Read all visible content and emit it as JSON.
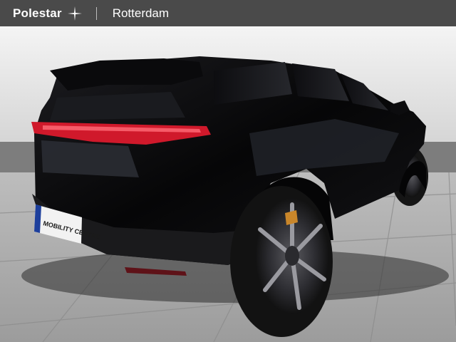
{
  "header": {
    "brand": "Polestar",
    "brand_icon": "polestar-star-icon",
    "location": "Rotterdam"
  },
  "photo": {
    "plate_text": "MOBILITY CENTRE"
  },
  "colors": {
    "header_bg": "#4a4a4a",
    "car_body": "#0b0b0d",
    "taillight": "#d0192b",
    "caliper": "#c9862a"
  }
}
